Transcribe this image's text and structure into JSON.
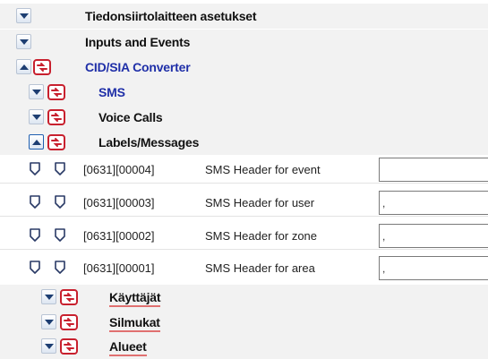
{
  "tree": {
    "top_sections": [
      {
        "label": "Tiedonsiirtolaitteen asetukset",
        "expander": "collapsed",
        "has_settings_icon": false,
        "color": "#111111"
      },
      {
        "label": "Inputs and Events",
        "expander": "collapsed",
        "has_settings_icon": false,
        "color": "#111111"
      },
      {
        "label": "CID/SIA Converter",
        "expander": "expanded",
        "has_settings_icon": true,
        "color": "#1f2fa8"
      }
    ],
    "converter_children": [
      {
        "label": "SMS",
        "expander": "collapsed",
        "color": "#1f2fa8"
      },
      {
        "label": "Voice Calls",
        "expander": "collapsed",
        "color": "#111111"
      },
      {
        "label": "Labels/Messages",
        "expander": "expanded",
        "color": "#111111"
      }
    ],
    "parameters": [
      {
        "code": "[0631][00004]",
        "name": "SMS Header for event",
        "value": ""
      },
      {
        "code": "[0631][00003]",
        "name": "SMS Header for user",
        "value": ","
      },
      {
        "code": "[0631][00002]",
        "name": "SMS Header for zone",
        "value": ","
      },
      {
        "code": "[0631][00001]",
        "name": "SMS Header for area",
        "value": ","
      }
    ],
    "label_groups": [
      {
        "label": "Käyttäjät",
        "expander": "collapsed"
      },
      {
        "label": "Silmukat",
        "expander": "collapsed"
      },
      {
        "label": "Alueet",
        "expander": "collapsed"
      }
    ]
  },
  "icons": {
    "expander_collapsed": "chevron-down-icon",
    "expander_expanded": "chevron-up-icon",
    "settings": "settings-icon",
    "parameter_marker": "shield-icon"
  },
  "colors": {
    "accent_blue": "#1f2fa8",
    "icon_red": "#c8202e",
    "underline_red": "#e07070",
    "row_gray": "#f2f2f2"
  }
}
